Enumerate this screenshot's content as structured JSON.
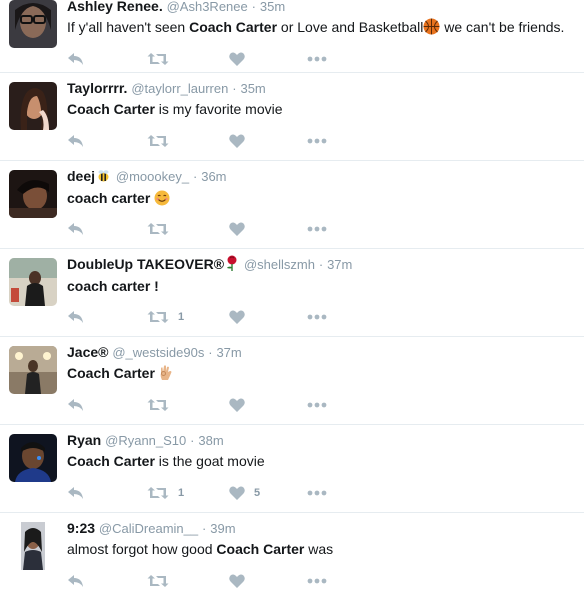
{
  "tweets": [
    {
      "name": "Ashley Renee.",
      "handle": "@Ash3Renee",
      "time": "35m",
      "text_parts": [
        "If y'all haven't seen ",
        "Coach Carter",
        " or Love and Basketball",
        "",
        " we can't be friends."
      ],
      "retweets": "",
      "likes": "",
      "emoji": "basketball"
    },
    {
      "name": "Taylorrrr.",
      "handle": "@taylorr_laurren",
      "time": "35m",
      "text_parts": [
        "",
        "Coach Carter",
        " is my favorite movie"
      ],
      "retweets": "",
      "likes": ""
    },
    {
      "name": "deej",
      "handle": "@moookey_",
      "time": "36m",
      "text_parts": [
        "coach carter "
      ],
      "retweets": "",
      "likes": "",
      "name_emoji": "bee",
      "emoji": "smile"
    },
    {
      "name": "DoubleUp TAKEOVER®",
      "handle": "@shellszmh",
      "time": "37m",
      "text_parts": [
        "coach carter !"
      ],
      "retweets": "1",
      "likes": "",
      "name_emoji": "rose"
    },
    {
      "name": "Jace®",
      "handle": "@_westside90s",
      "time": "37m",
      "text_parts": [
        "",
        "Coach Carter",
        " "
      ],
      "retweets": "",
      "likes": "",
      "emoji": "ok-hand"
    },
    {
      "name": "Ryan",
      "handle": "@Ryann_S10",
      "time": "38m",
      "text_parts": [
        "",
        "Coach Carter",
        " is the goat movie"
      ],
      "retweets": "1",
      "likes": "5"
    },
    {
      "name": "9:23",
      "handle": "@CaliDreamin__",
      "time": "39m",
      "text_parts": [
        "almost forgot how good ",
        "Coach Carter",
        " was"
      ],
      "retweets": "",
      "likes": ""
    }
  ],
  "separator": "·",
  "colors": {
    "icon": "#aab8c2",
    "meta": "#8899a6",
    "text": "#14171a",
    "divider": "#e6ecf0"
  },
  "icons": [
    "reply-icon",
    "retweet-icon",
    "like-icon",
    "more-icon"
  ]
}
